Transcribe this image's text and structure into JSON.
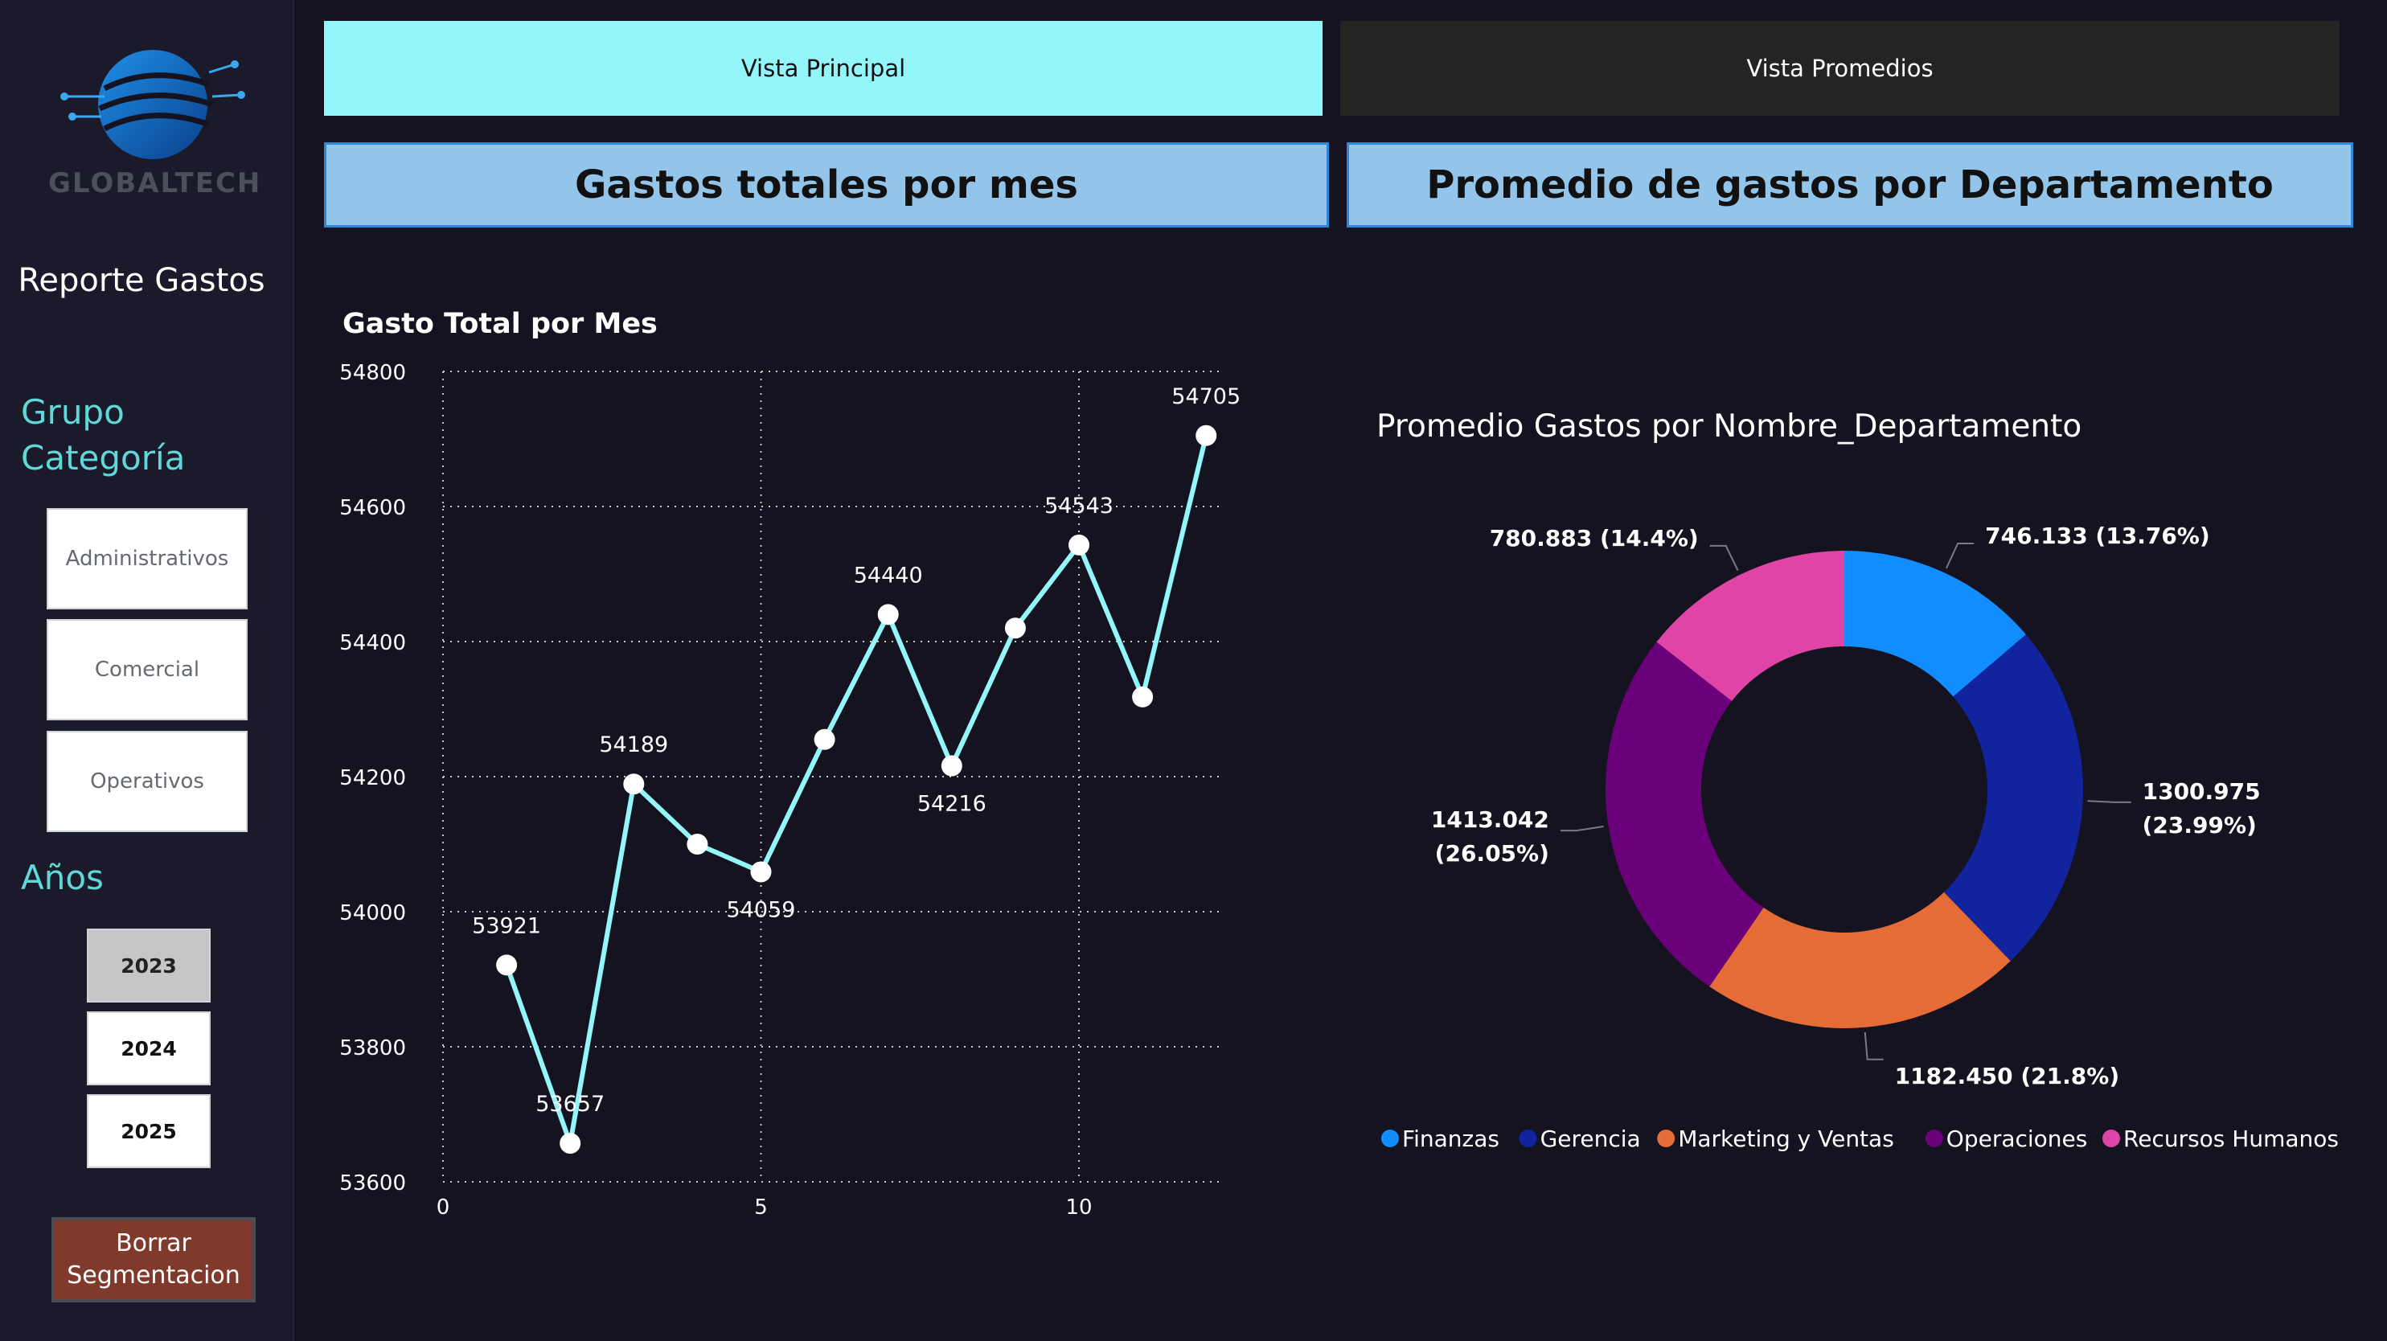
{
  "sidebar": {
    "logo_text": "GLOBALTECH",
    "report_title": "Reporte Gastos",
    "category_slicer": {
      "title_line1": "Grupo",
      "title_line2": "Categoría",
      "options": [
        "Administrativos",
        "Comercial",
        "Operativos"
      ]
    },
    "year_slicer": {
      "title": "Años",
      "options": [
        "2023",
        "2024",
        "2025"
      ],
      "selected": "2023"
    },
    "clear_button_line1": "Borrar",
    "clear_button_line2": "Segmentacion"
  },
  "nav": {
    "main_label": "Vista Principal",
    "avg_label": "Vista Promedios"
  },
  "sections": {
    "left_header": "Gastos totales por mes",
    "right_header": "Promedio de gastos por Departamento"
  },
  "colors": {
    "line": "#93f6fb",
    "finanzas": "#118dff",
    "gerencia": "#12239e",
    "marketing": "#e66c37",
    "operaciones": "#6b007b",
    "recursos_humanos": "#e044a7"
  },
  "chart_data": [
    {
      "type": "line",
      "title": "Gasto Total por Mes",
      "x": [
        1,
        2,
        3,
        4,
        5,
        6,
        7,
        8,
        9,
        10,
        11,
        12
      ],
      "series": [
        {
          "values": [
            53921,
            53657,
            54189,
            54100,
            54059,
            54255,
            54440,
            54216,
            54420,
            54543,
            54318,
            54705
          ]
        }
      ],
      "data_labels": [
        {
          "x": 1,
          "text": "53921",
          "pos": "above"
        },
        {
          "x": 2,
          "text": "53657",
          "pos": "above"
        },
        {
          "x": 3,
          "text": "54189",
          "pos": "above"
        },
        {
          "x": 5,
          "text": "54059",
          "pos": "below"
        },
        {
          "x": 7,
          "text": "54440",
          "pos": "above"
        },
        {
          "x": 8,
          "text": "54216",
          "pos": "below"
        },
        {
          "x": 10,
          "text": "54543",
          "pos": "above"
        },
        {
          "x": 12,
          "text": "54705",
          "pos": "above"
        }
      ],
      "xticks": [
        0,
        5,
        10
      ],
      "yticks": [
        53600,
        53800,
        54000,
        54200,
        54400,
        54600,
        54800
      ],
      "xlim": [
        0,
        12.25
      ],
      "ylim": [
        53600,
        54800
      ],
      "grid": true
    },
    {
      "type": "pie",
      "title": "Promedio Gastos por Nombre_Departamento",
      "donut": true,
      "legend_position": "bottom",
      "slices": [
        {
          "name": "Finanzas",
          "value": 746.133,
          "label": "746.133 (13.76%)"
        },
        {
          "name": "Gerencia",
          "value": 1300.975,
          "label_line1": "1300.975",
          "label_line2": "(23.99%)"
        },
        {
          "name": "Marketing y Ventas",
          "value": 1182.45,
          "label": "1182.450 (21.8%)"
        },
        {
          "name": "Operaciones",
          "value": 1413.042,
          "label_line1": "1413.042",
          "label_line2": "(26.05%)"
        },
        {
          "name": "Recursos Humanos",
          "value": 780.883,
          "label": "780.883 (14.4%)"
        }
      ]
    }
  ]
}
